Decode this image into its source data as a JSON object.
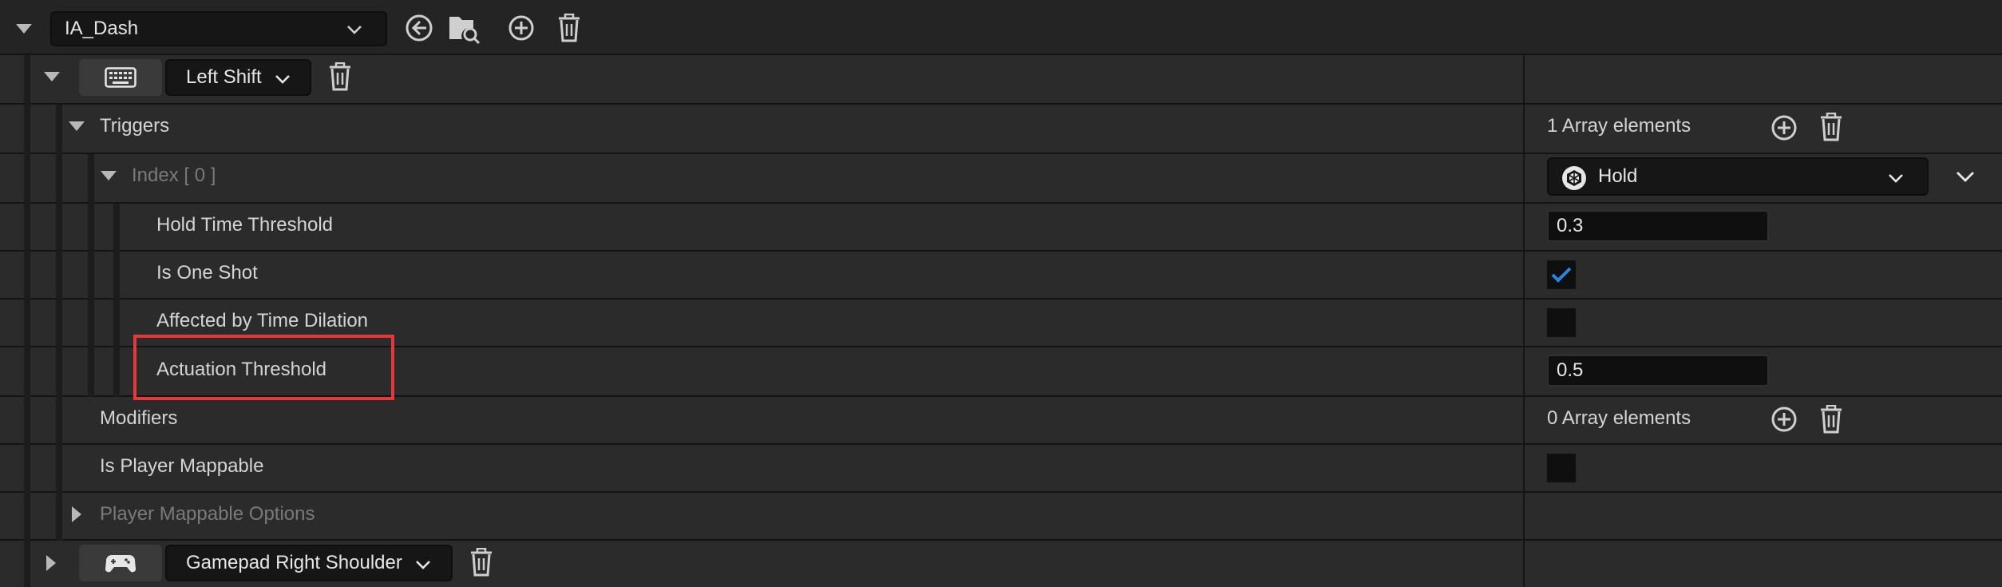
{
  "header": {
    "action_name": "IA_Dash"
  },
  "mappings": [
    {
      "key_label": "Left Shift",
      "device_icon": "keyboard-icon"
    },
    {
      "key_label": "Gamepad Right Shoulder",
      "device_icon": "gamepad-icon"
    }
  ],
  "triggers": {
    "label": "Triggers",
    "count_text": "1 Array elements",
    "index_label": "Index [ 0 ]",
    "trigger_type": "Hold",
    "properties": {
      "hold_time_threshold": {
        "label": "Hold Time Threshold",
        "value": "0.3"
      },
      "is_one_shot": {
        "label": "Is One Shot",
        "checked": true
      },
      "affected_by_time_dilation": {
        "label": "Affected by Time Dilation",
        "checked": false
      },
      "actuation_threshold": {
        "label": "Actuation Threshold",
        "value": "0.5"
      }
    }
  },
  "modifiers": {
    "label": "Modifiers",
    "count_text": "0 Array elements"
  },
  "is_player_mappable": {
    "label": "Is Player Mappable",
    "checked": false
  },
  "player_mappable_options": {
    "label": "Player Mappable Options"
  },
  "colors": {
    "accent_check": "#2a84e0",
    "highlight": "#e5383b"
  }
}
